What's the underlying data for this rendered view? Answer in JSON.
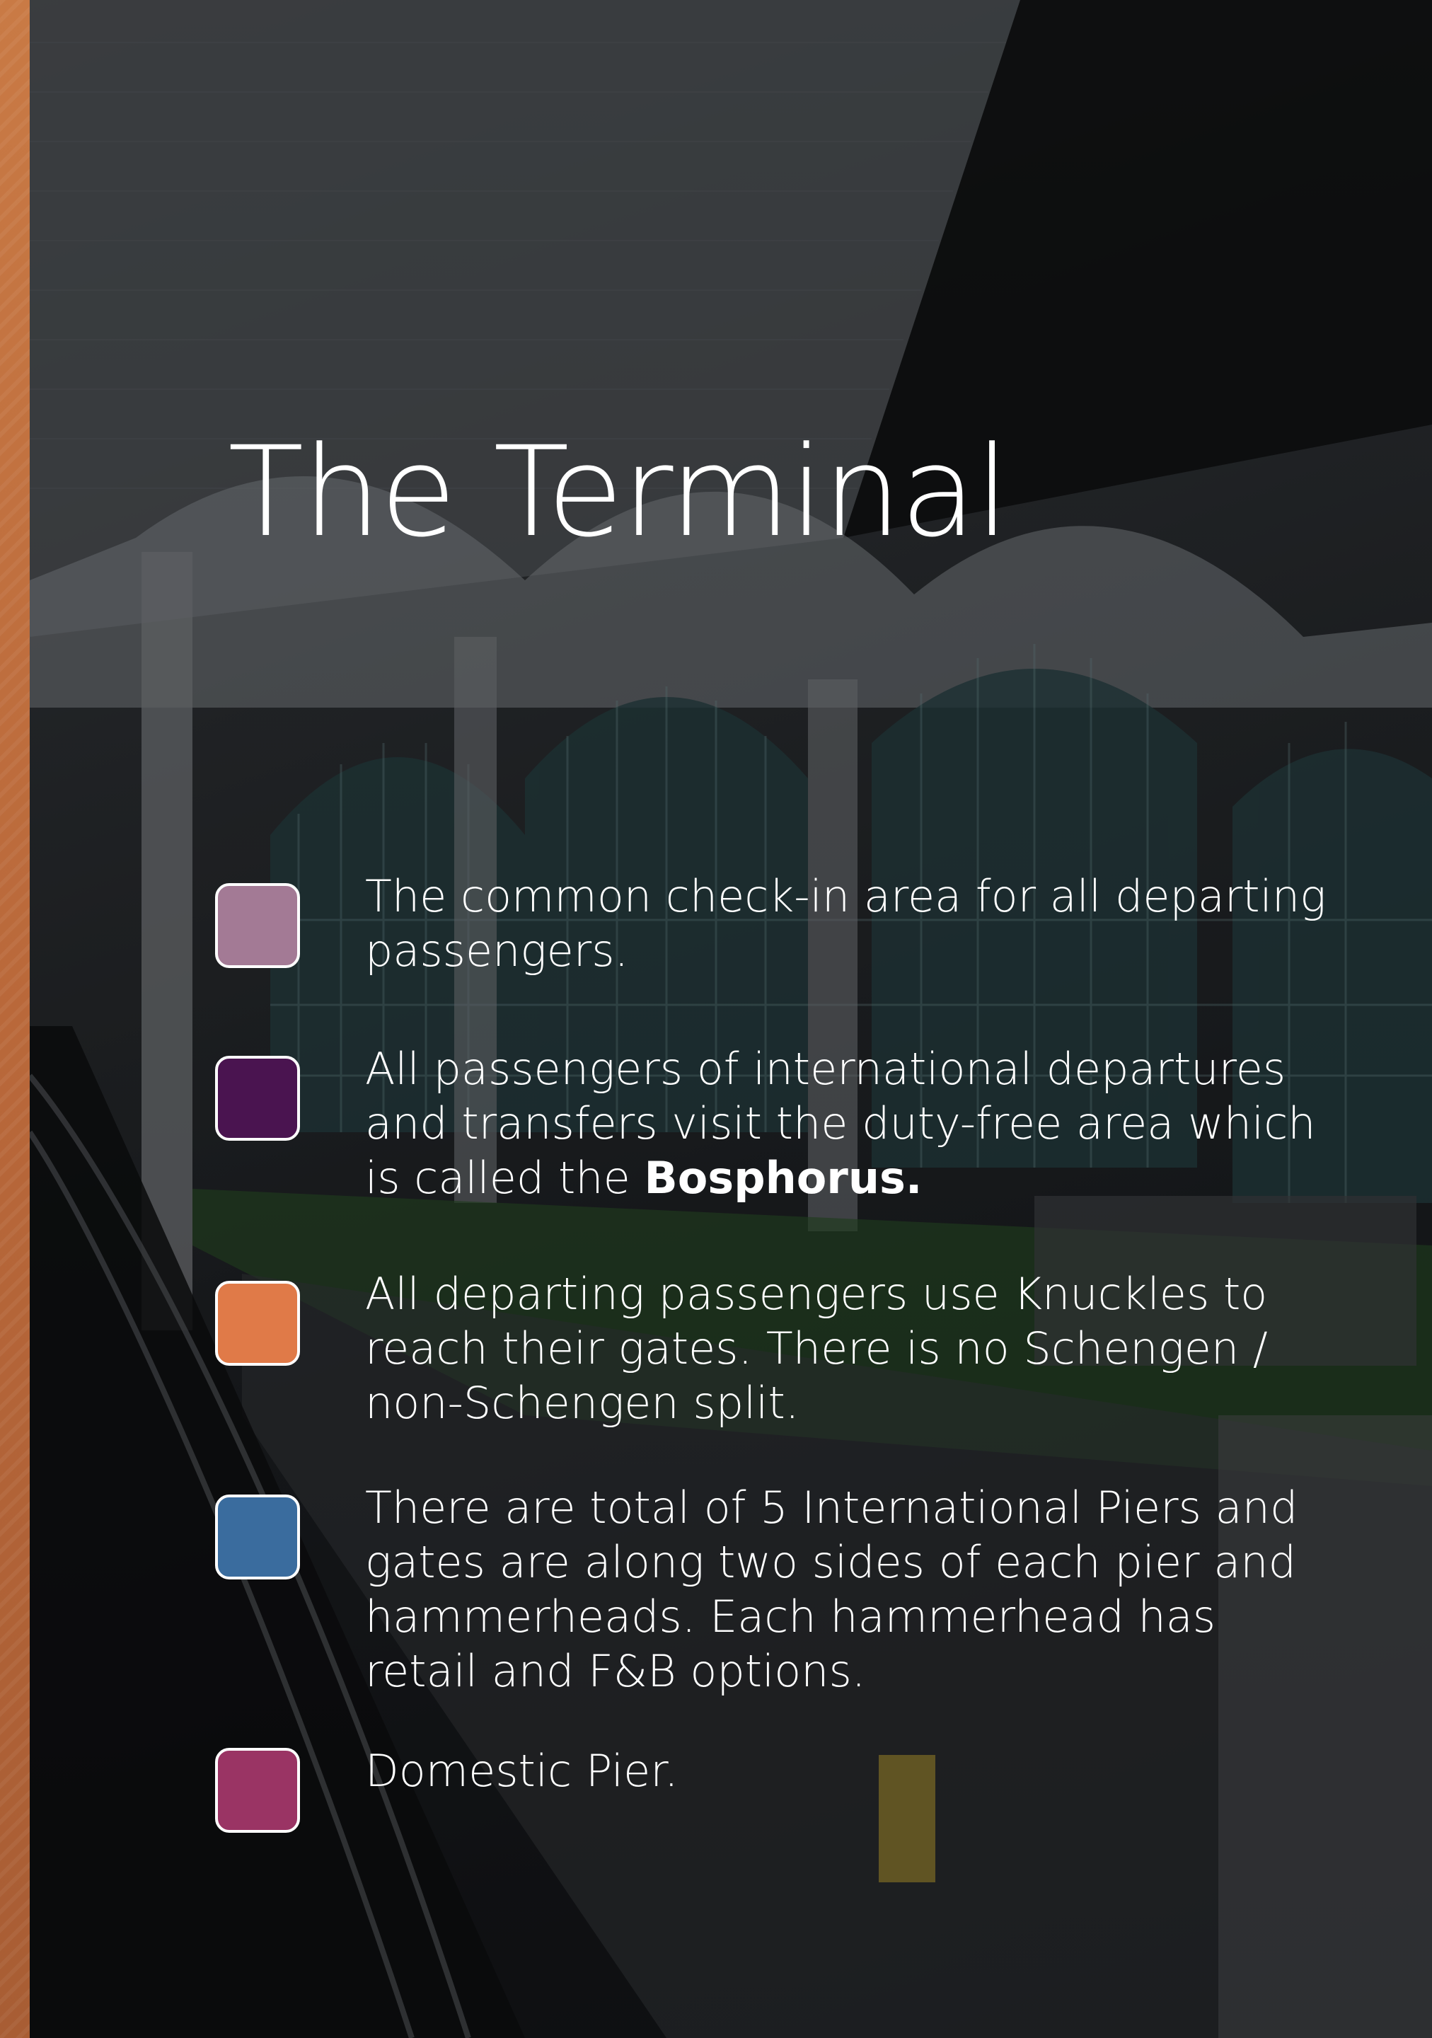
{
  "page": {
    "title": "The Terminal",
    "accent_stripe_color": "#c0713f"
  },
  "legend": [
    {
      "swatch_color": "#a37a95",
      "text": "The common check-in area for all departing passengers."
    },
    {
      "swatch_color": "#4a1450",
      "text_before": "All passengers of international departures and transfers visit the duty-free area which is called the ",
      "text_bold": "Bosphorus."
    },
    {
      "swatch_color": "#e07a48",
      "text": "All departing passengers use Knuckles to reach their gates. There is no Schengen / non-Schengen split."
    },
    {
      "swatch_color": "#3a6c9e",
      "text": "There are total of 5 International Piers and gates are along two sides of each pier and hammerheads. Each hammerhead has retail and F&B options."
    },
    {
      "swatch_color": "#9a3464",
      "text": "Domestic Pier."
    }
  ]
}
